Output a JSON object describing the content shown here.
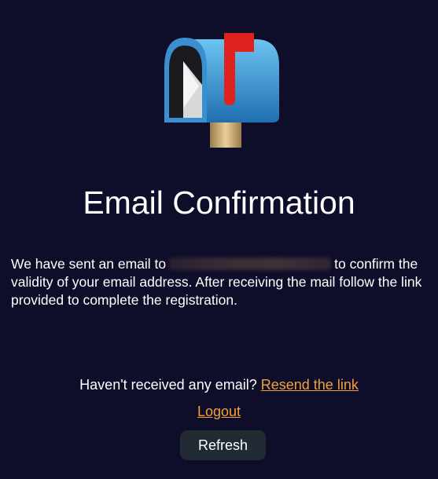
{
  "page": {
    "icon": "mailbox-flag-up-icon",
    "title": "Email Confirmation",
    "message_before": "We have sent an email to",
    "message_after": "to confirm the validity of your email address. After receiving the mail follow the link provided to complete the registration.",
    "resend_prompt": "Haven't received any email?",
    "resend_link": "Resend the link",
    "logout_link": "Logout",
    "refresh_button": "Refresh"
  },
  "colors": {
    "background": "#0e0e2b",
    "link": "#f0a13a",
    "button": "#222a33"
  }
}
